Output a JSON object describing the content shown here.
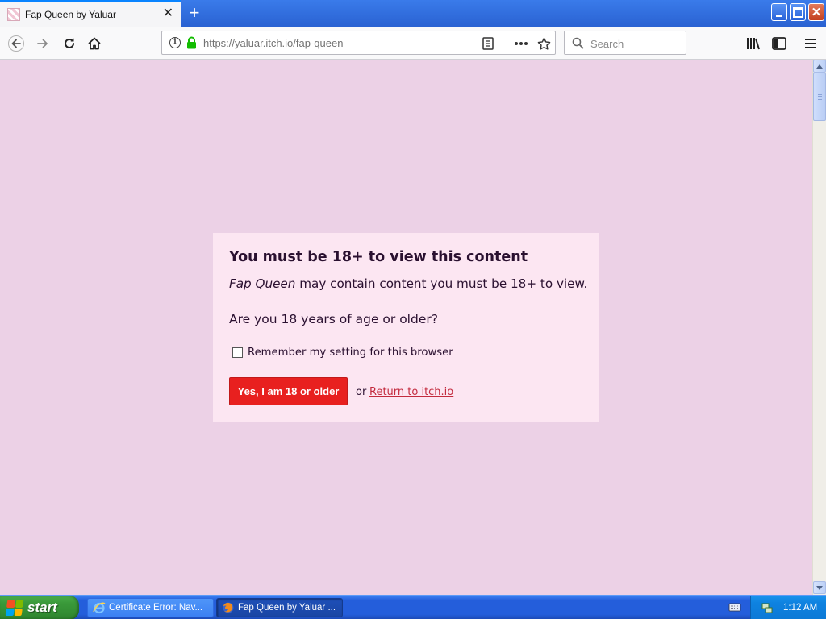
{
  "browser": {
    "tab": {
      "title": "Fap Queen by Yaluar",
      "close_label": "✕"
    },
    "new_tab_label": "+",
    "url": "https://yaluar.itch.io/fap-queen",
    "search_placeholder": "Search",
    "window_close_label": "✕"
  },
  "age_gate": {
    "title": "You must be 18+ to view this content",
    "game_name": "Fap Queen",
    "description_rest": " may contain content you must be 18+ to view.",
    "question": "Are you 18 years of age or older?",
    "remember_label": "Remember my setting for this browser",
    "remember_checked": false,
    "confirm_label": "Yes, I am 18 or older",
    "or_text": "or",
    "return_label": "Return to itch.io"
  },
  "taskbar": {
    "start_label": "start",
    "tasks": [
      {
        "label": "Certificate Error: Nav...",
        "active": false
      },
      {
        "label": "Fap Queen by Yaluar ...",
        "active": true
      }
    ],
    "clock": "1:12 AM"
  },
  "colors": {
    "page_background": "#ecd1e6",
    "gate_background": "#fce6f2",
    "confirm_button": "#e8201f",
    "link": "#c32b3e"
  }
}
